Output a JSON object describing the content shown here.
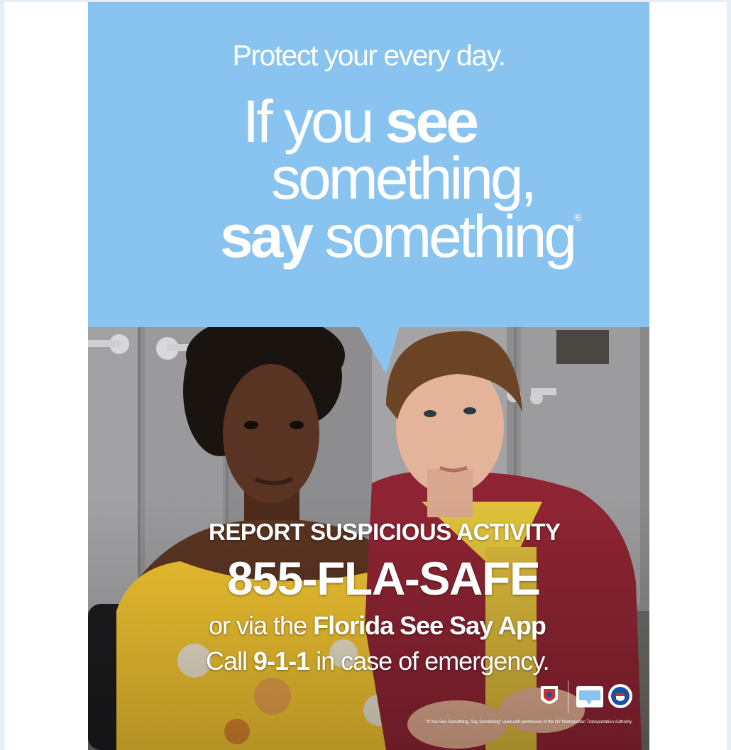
{
  "poster": {
    "tagline": "Protect your every day.",
    "headline": {
      "line1_pre": "If you ",
      "line1_bold": "see",
      "line2": "something,",
      "line3_bold": "say",
      "line3_post": " something",
      "trademark": "®"
    },
    "cta": {
      "report": "REPORT SUSPICIOUS ACTIVITY",
      "phone": "855-FLA-SAFE",
      "app_pre": "or via the ",
      "app_bold": "Florida See Say App",
      "call_pre": "Call ",
      "call_bold": "9-1-1",
      "call_post": " in case of emergency."
    },
    "logos": [
      "florida-seal-icon",
      "see-say-app-icon",
      "dhs-seal-icon"
    ],
    "disclaimer": "\"If You See Something, Say Something\" used with permission of the NY Metropolitan Transportation Authority."
  },
  "colors": {
    "sky": "#88c4ef",
    "text": "#ffffff",
    "shirt_yellow": "#f0c230",
    "hoodie_red": "#8e2433",
    "skin_dark": "#5a3422",
    "skin_light": "#e4b49a"
  }
}
